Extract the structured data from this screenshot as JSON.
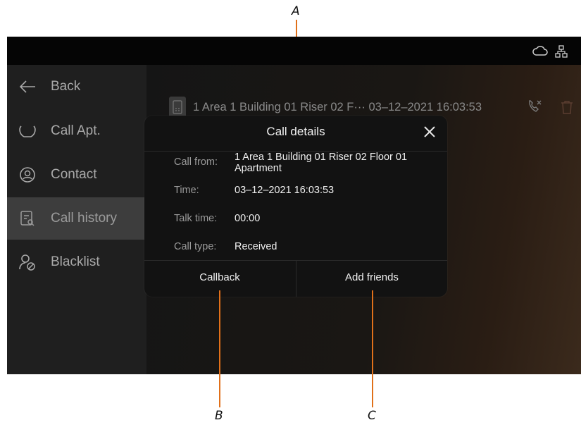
{
  "annotations": {
    "a": "A",
    "b": "B",
    "c": "C"
  },
  "sidebar": {
    "back": "Back",
    "items": [
      {
        "label": "Call Apt."
      },
      {
        "label": "Contact"
      },
      {
        "label": "Call history"
      },
      {
        "label": "Blacklist"
      }
    ]
  },
  "history_row": {
    "text": "1 Area 1 Building 01 Riser 02 F··· 03–12–2021 16:03:53"
  },
  "dialog": {
    "title": "Call details",
    "rows": [
      {
        "label": "Call from:",
        "value": "1 Area 1 Building 01 Riser 02 Floor 01 Apartment"
      },
      {
        "label": "Time:",
        "value": "03–12–2021 16:03:53"
      },
      {
        "label": "Talk time:",
        "value": "00:00"
      },
      {
        "label": "Call type:",
        "value": "Received"
      }
    ],
    "callback_label": "Callback",
    "add_friends_label": "Add friends"
  },
  "colors": {
    "accent": "#e0701a",
    "dialog_bg": "#121212",
    "active_item": "#3d3d3d"
  },
  "icons": [
    "cloud-icon",
    "network-icon",
    "back-arrow-icon",
    "call-apt-icon",
    "contact-icon",
    "call-history-icon",
    "blacklist-icon",
    "phone-device-icon",
    "missed-call-icon",
    "trash-icon",
    "close-icon"
  ]
}
